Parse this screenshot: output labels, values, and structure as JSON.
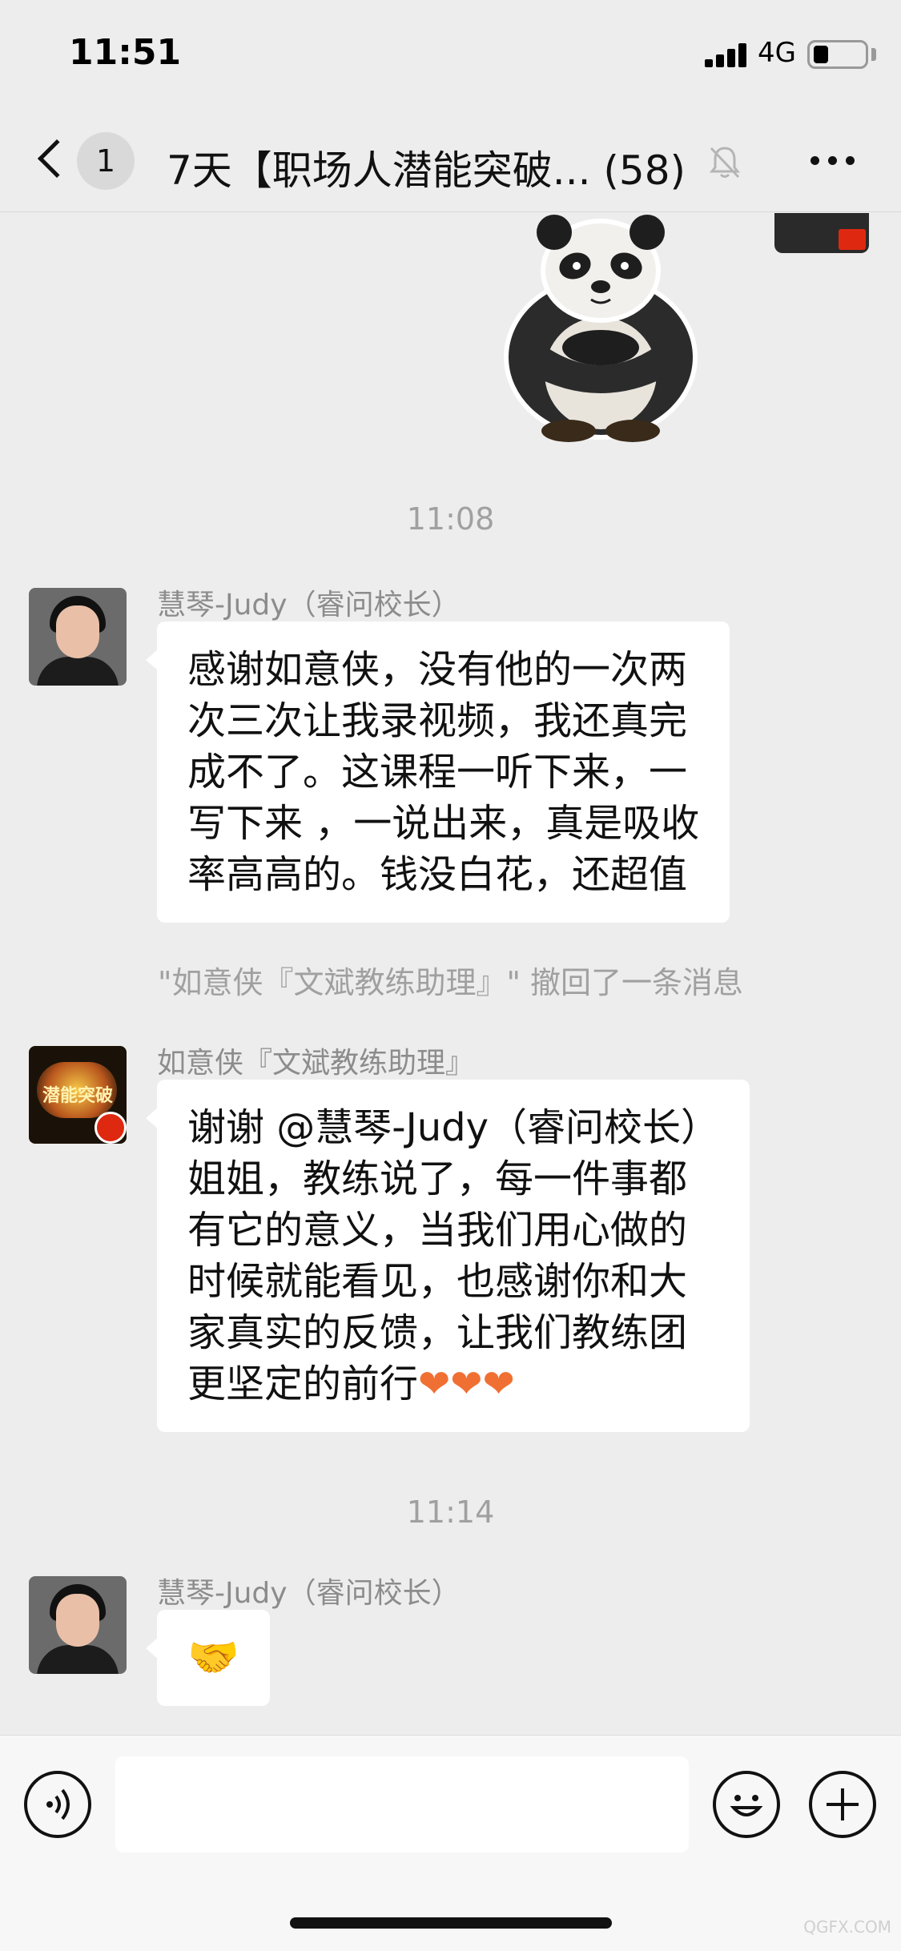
{
  "status_bar": {
    "time": "11:51",
    "network": "4G"
  },
  "nav": {
    "unread_count": "1",
    "title": "7天【职场人潜能突破... (58)",
    "icons": {
      "back": "chevron-left-icon",
      "mute": "bell-slash-icon",
      "more": "ellipsis-icon"
    }
  },
  "chat": {
    "time_1": "11:08",
    "msg_1": {
      "sender": "慧琴-Judy（睿问校长）",
      "lines": [
        "感谢如意侠，没有他的一次两",
        "次三次让我录视频，我还真完",
        "成不了。这课程一听下来，一",
        "写下来 ，一说出来，真是吸收",
        "率高高的。钱没白花，还超值"
      ]
    },
    "notice": "\"如意侠『文斌教练助理』\" 撤回了一条消息",
    "msg_2": {
      "sender": "如意侠『文斌教练助理』",
      "avatar_text": "潜能突破",
      "lines": [
        "谢谢 @慧琴-Judy（睿问校长）",
        " 姐姐，教练说了，每一件事都",
        "有它的意义，当我们用心做的",
        "时候就能看见，也感谢你和大",
        "家真实的反馈，让我们教练团",
        "更坚定的前行"
      ],
      "hearts": "❤❤❤"
    },
    "time_2": "11:14",
    "msg_3": {
      "sender": "慧琴-Judy（睿问校长）",
      "emoji": "🤝"
    }
  },
  "input_bar": {
    "value": "",
    "icons": {
      "voice": "voice-icon",
      "emoji": "smiley-icon",
      "more": "plus-icon"
    }
  },
  "watermark": "QGFX.COM"
}
